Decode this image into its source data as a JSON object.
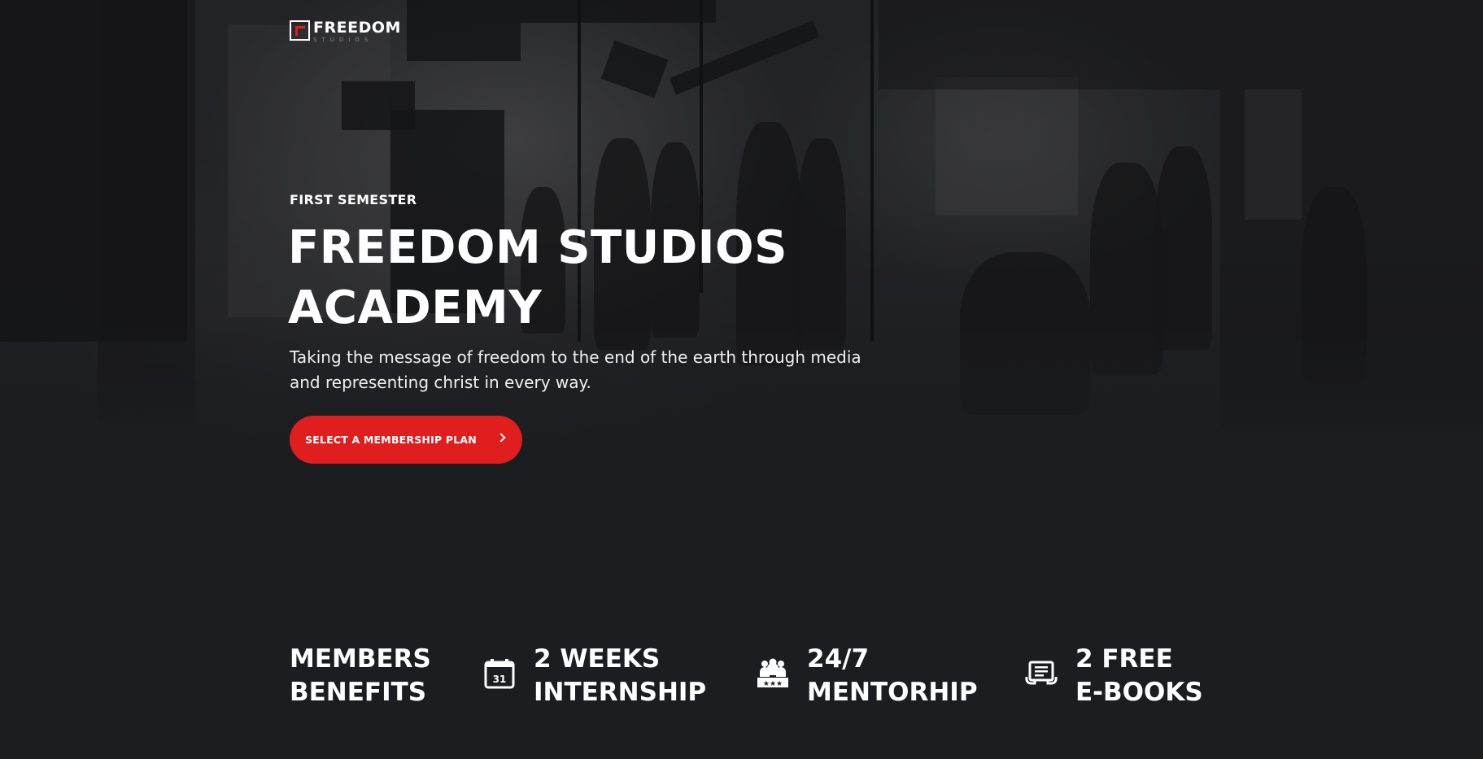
{
  "brand": {
    "name": "FREEDOM",
    "sub": "STUDIOS"
  },
  "hero": {
    "eyebrow": "FIRST SEMESTER",
    "headline_line1": "FREEDOM STUDIOS",
    "headline_line2": "ACADEMY",
    "subtitle_line1": "Taking the message of freedom to the end of the earth through media",
    "subtitle_line2": "and representing christ in every way.",
    "cta_label": "SELECT A MEMBERSHIP PLAN",
    "cta_icon": "chevron-right-icon"
  },
  "benefits": {
    "title_line1": "MEMBERS",
    "title_line2": "BENEFITS",
    "items": [
      {
        "line1": "2 WEEKS",
        "line2": "INTERNSHIP",
        "icon": "calendar-icon",
        "icon_text": "31"
      },
      {
        "line1": "24/7",
        "line2": "MENTORHIP",
        "icon": "group-icon"
      },
      {
        "line1": "2 FREE",
        "line2": "E-BOOKS",
        "icon": "ebook-reader-icon"
      }
    ]
  },
  "colors": {
    "accent": "#e01e1e",
    "background": "#1b1d20",
    "text": "#ffffff"
  }
}
